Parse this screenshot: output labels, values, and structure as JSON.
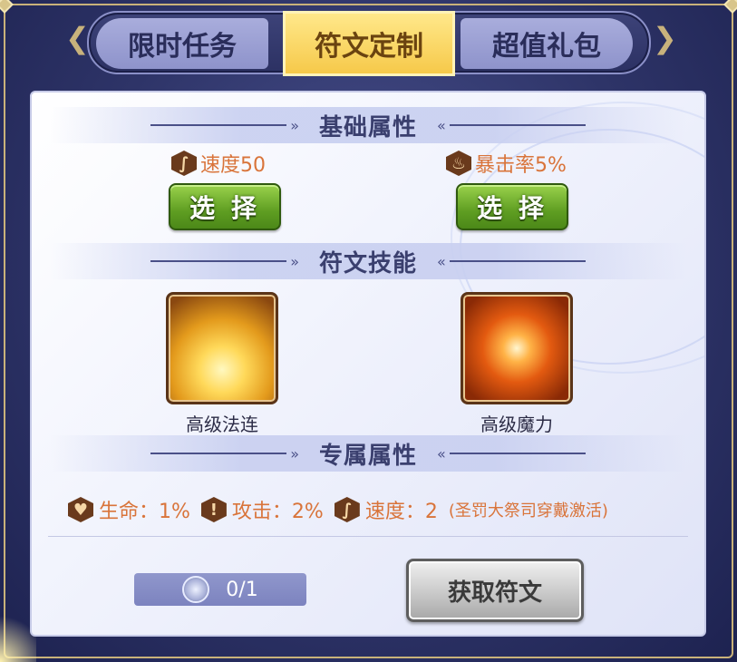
{
  "tabs": [
    {
      "label": "限时任务",
      "active": false
    },
    {
      "label": "符文定制",
      "active": true
    },
    {
      "label": "超值礼包",
      "active": false
    }
  ],
  "sections": {
    "basic": "基础属性",
    "skill": "符文技能",
    "exclusive": "专属属性"
  },
  "basic_attrs": [
    {
      "icon": "speed-icon",
      "text": "速度50",
      "button": "选 择"
    },
    {
      "icon": "crit-icon",
      "text": "暴击率5%",
      "button": "选 择"
    }
  ],
  "skills": [
    {
      "icon": "advanced-chain-skill-icon",
      "name": "高级法连"
    },
    {
      "icon": "advanced-magic-skill-icon",
      "name": "高级魔力"
    }
  ],
  "exclusive_attrs": [
    {
      "icon": "heart-icon",
      "text": "生命：1%"
    },
    {
      "icon": "attack-icon",
      "text": "攻击：2%"
    },
    {
      "icon": "speed-icon",
      "text": "速度：2"
    }
  ],
  "exclusive_note": "(圣罚大祭司穿戴激活)",
  "counter": "0/1",
  "get_button": "获取符文",
  "colors": {
    "accent_orange": "#d9743a",
    "tab_active": "#f6c94a",
    "button_green": "#5f9e22"
  }
}
